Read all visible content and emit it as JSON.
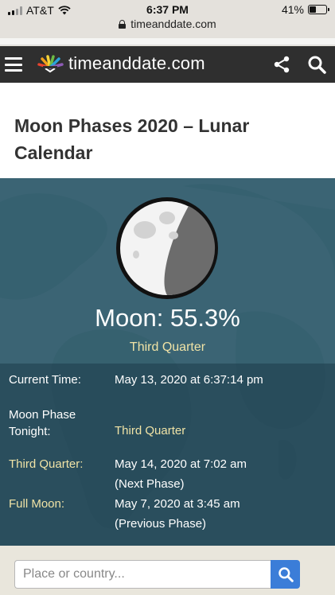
{
  "status_bar": {
    "carrier": "AT&T",
    "time": "6:37 PM",
    "battery": "41%",
    "battery_level": 0.41,
    "url": "timeanddate.com"
  },
  "header": {
    "logo_text": "timeanddate.com",
    "icons": [
      "hamburger-menu-icon",
      "share-icon",
      "search-icon"
    ]
  },
  "page": {
    "title": "Moon Phases 2020 – Lunar Calendar"
  },
  "moon": {
    "illumination_label": "Moon: 55.3%",
    "illumination_value": 55.3,
    "phase_name": "Third Quarter"
  },
  "details": [
    {
      "label": "Current Time:",
      "value": "May 13, 2020 at 6:37:14 pm"
    },
    {
      "label": "Moon Phase Tonight:",
      "value": "Third Quarter"
    },
    {
      "label": "Third Quarter:",
      "value": "May 14, 2020 at 7:02 am",
      "note": "(Next Phase)"
    },
    {
      "label": "Full Moon:",
      "value": "May 7, 2020 at 3:45 am",
      "note": "(Previous Phase)"
    }
  ],
  "search": {
    "placeholder": "Place or country..."
  },
  "colors": {
    "panel": "#3b6474",
    "accent_yellow": "#f0e3a6",
    "header": "#2f2f2f",
    "search_button": "#3b7dd8"
  }
}
